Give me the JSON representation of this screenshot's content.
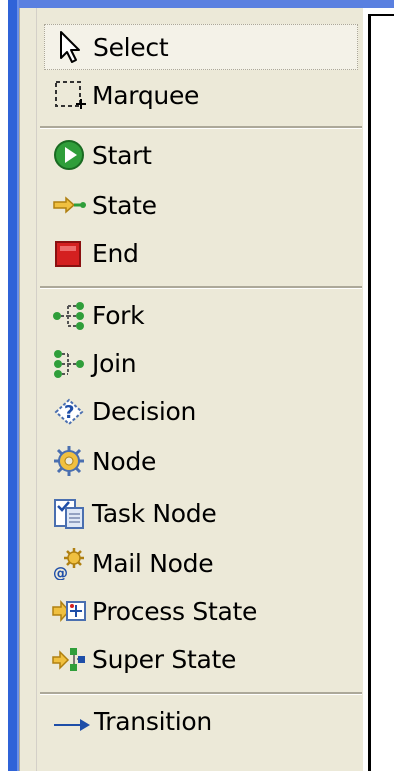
{
  "palette": {
    "items": [
      {
        "label": "Select",
        "icon": "cursor-arrow-icon"
      },
      {
        "label": "Marquee",
        "icon": "marquee-icon"
      },
      {
        "label": "Start",
        "icon": "start-icon"
      },
      {
        "label": "State",
        "icon": "state-icon"
      },
      {
        "label": "End",
        "icon": "end-icon"
      },
      {
        "label": "Fork",
        "icon": "fork-icon"
      },
      {
        "label": "Join",
        "icon": "join-icon"
      },
      {
        "label": "Decision",
        "icon": "decision-icon"
      },
      {
        "label": "Node",
        "icon": "node-gear-icon"
      },
      {
        "label": "Task Node",
        "icon": "task-node-icon"
      },
      {
        "label": "Mail Node",
        "icon": "mail-node-icon"
      },
      {
        "label": "Process State",
        "icon": "process-state-icon"
      },
      {
        "label": "Super State",
        "icon": "super-state-icon"
      },
      {
        "label": "Transition",
        "icon": "transition-arrow-icon"
      }
    ],
    "selected": "Select"
  },
  "colors": {
    "palette_bg": "#ece9d8",
    "frame_blue": "#2f63d8",
    "start_green": "#2f9e3a",
    "end_red": "#d42020"
  }
}
